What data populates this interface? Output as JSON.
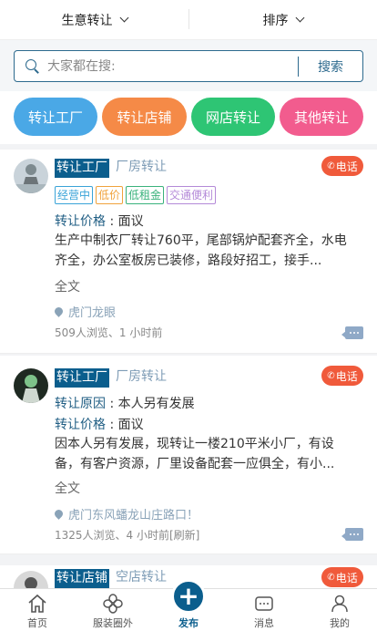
{
  "filters": {
    "left_label": "生意转让",
    "right_label": "排序"
  },
  "search": {
    "placeholder": "大家都在搜:",
    "button_label": "搜索"
  },
  "categories": [
    {
      "label": "转让工厂",
      "color": "#4aa8e6"
    },
    {
      "label": "转让店铺",
      "color": "#f58a47"
    },
    {
      "label": "网店转让",
      "color": "#2ec574"
    },
    {
      "label": "其他转让",
      "color": "#f25c8e"
    }
  ],
  "listings": [
    {
      "tag": "转让工厂",
      "category": "厂房转让",
      "call_label": "电话",
      "badges": [
        {
          "label": "经营中",
          "color": "#3aa3d8"
        },
        {
          "label": "低价",
          "color": "#f0a23c"
        },
        {
          "label": "低租金",
          "color": "#3ab27c"
        },
        {
          "label": "交通便利",
          "color": "#b48ad8"
        }
      ],
      "price_label": "转让价格",
      "price_value": "面议",
      "description": "生产中制衣厂转让760平，尾部锅炉配套齐全，水电齐全，办公室板房已装修，路段好招工，接手...",
      "full_text_label": "全文",
      "location": "虎门龙眼",
      "meta": "509人浏览、1 小时前"
    },
    {
      "tag": "转让工厂",
      "category": "厂房转让",
      "call_label": "电话",
      "reason_label": "转让原因",
      "reason_value": "本人另有发展",
      "price_label": "转让价格",
      "price_value": "面议",
      "description": "因本人另有发展，现转让一楼210平米小厂，有设备，有客户资源，厂里设备配套一应俱全，有小...",
      "full_text_label": "全文",
      "location": "虎门东风蟠龙山庄路口！",
      "meta": "1325人浏览、4 小时前[刷新]"
    },
    {
      "tag": "转让店铺",
      "category": "空店转让",
      "call_label": "电话"
    }
  ],
  "tabbar": {
    "home": "首页",
    "circle": "服装圈外",
    "publish": "发布",
    "messages": "消息",
    "mine": "我的"
  }
}
